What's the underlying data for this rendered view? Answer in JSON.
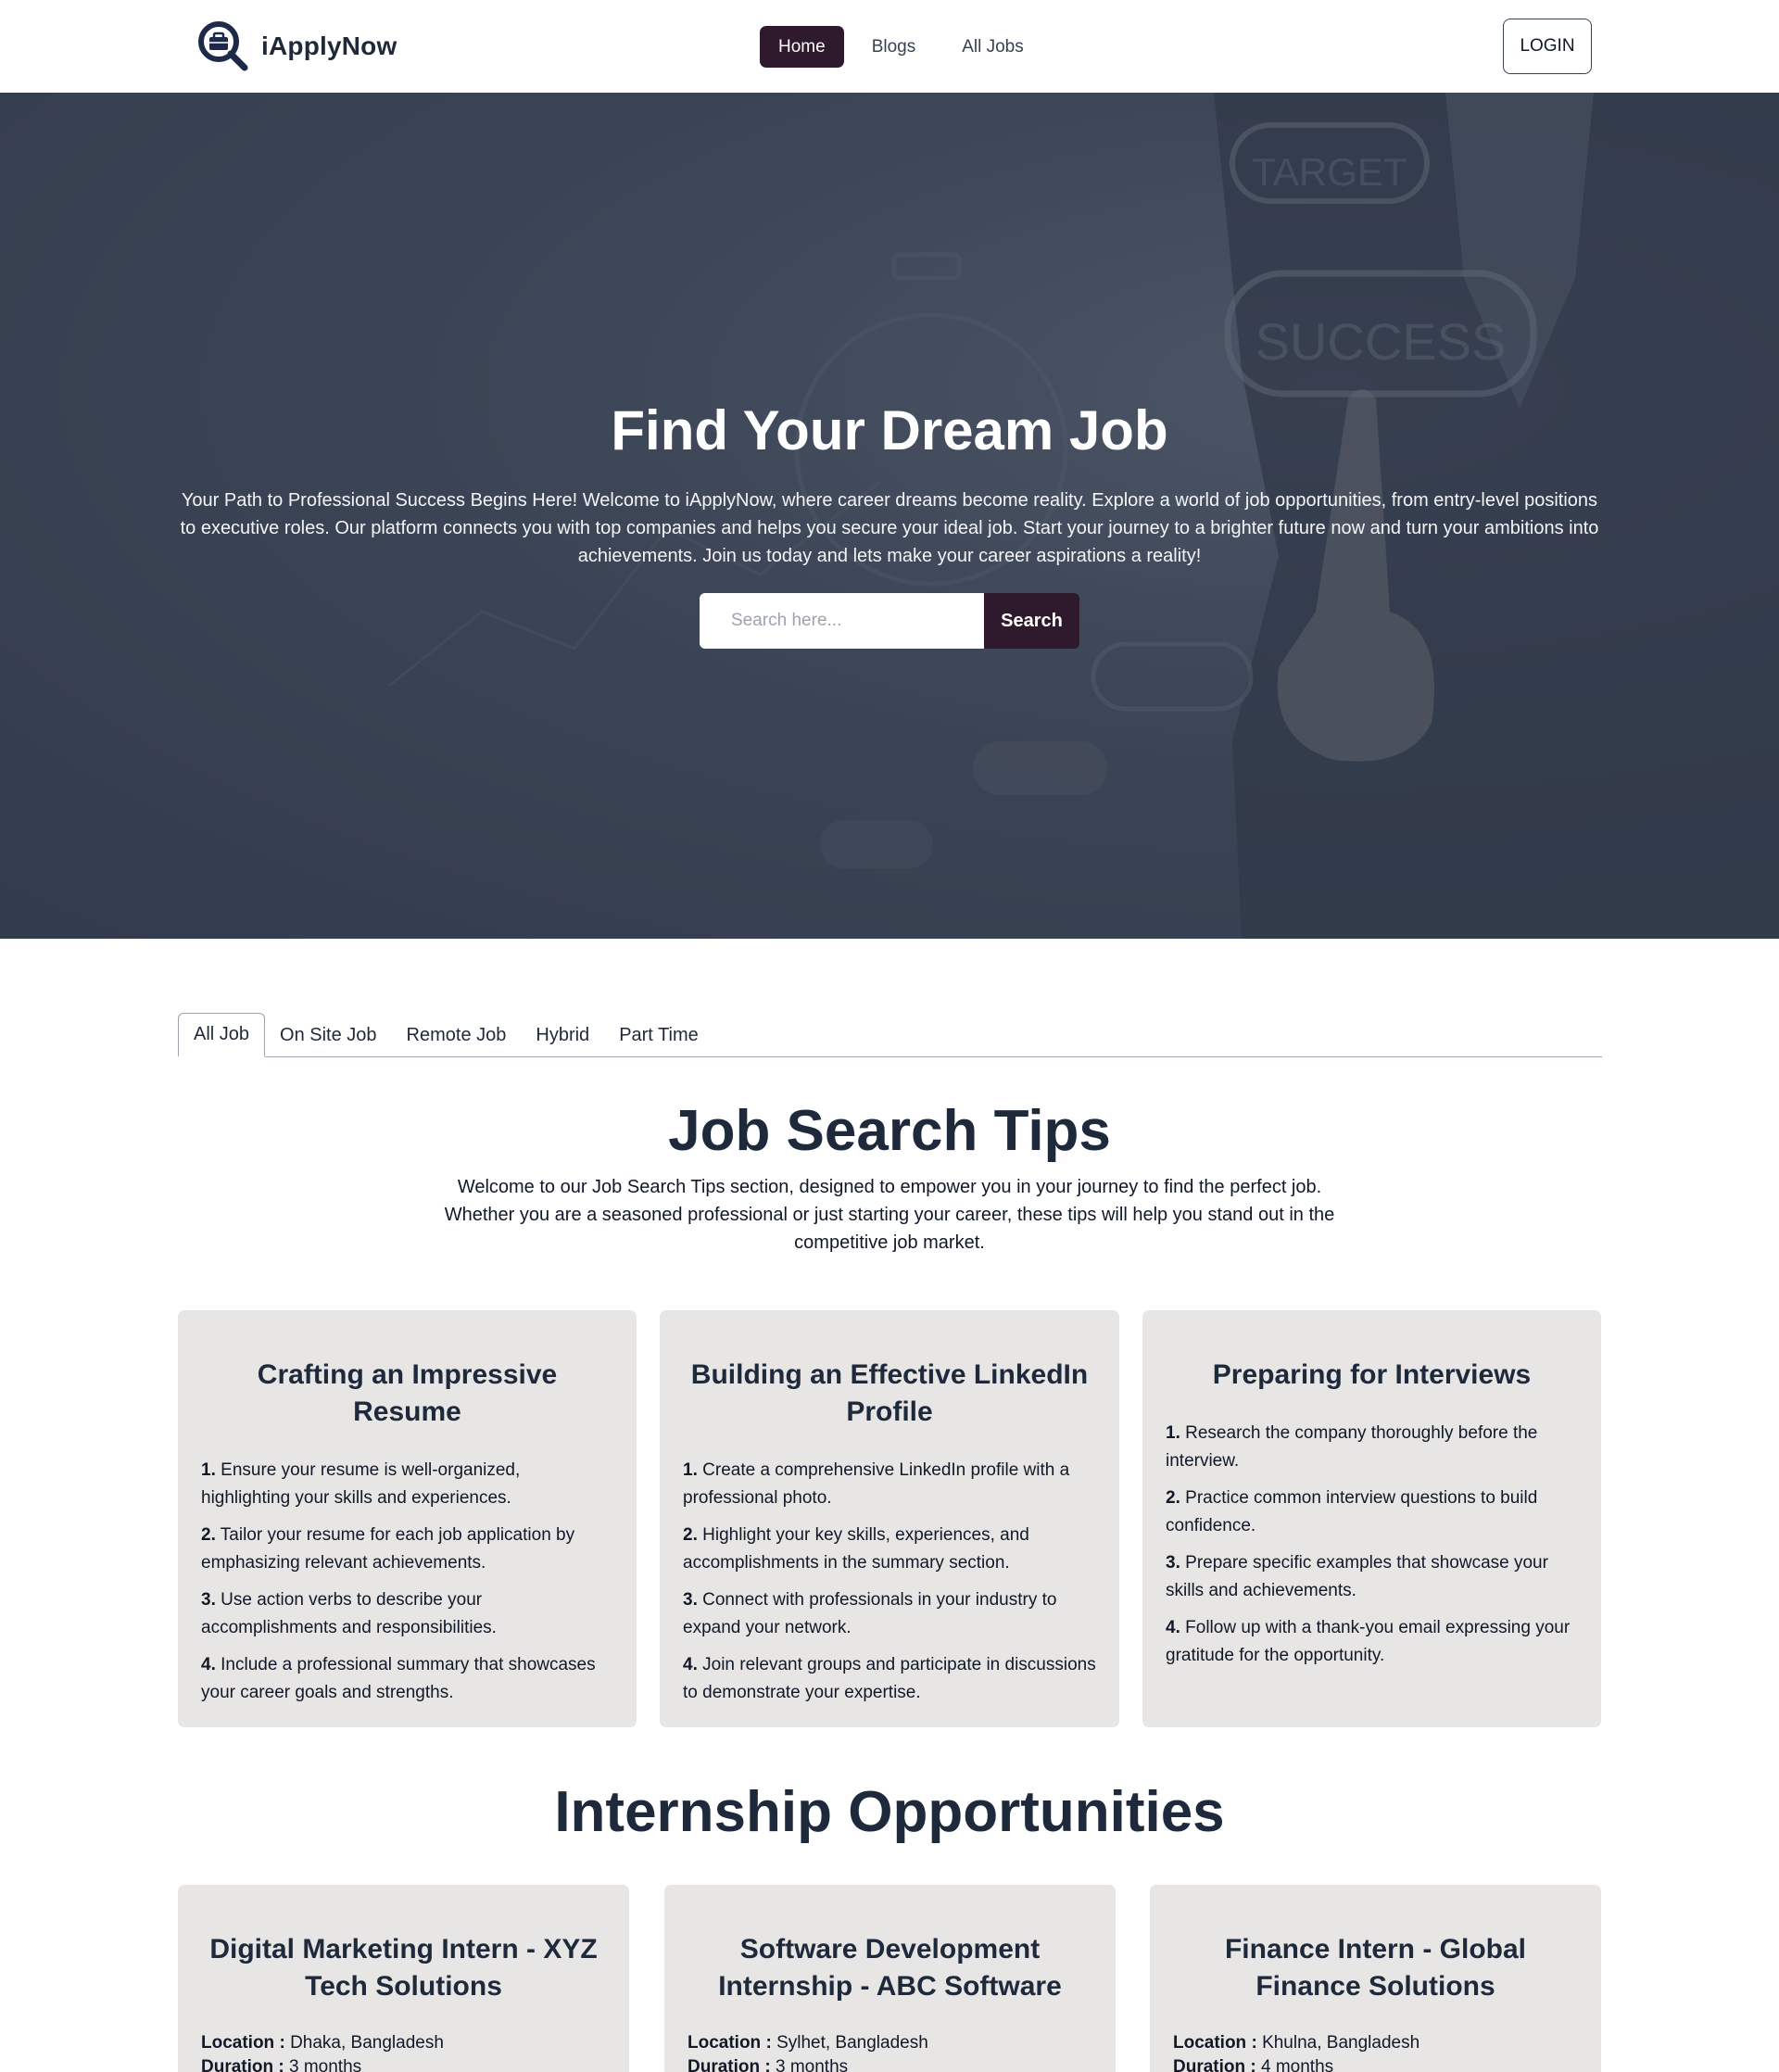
{
  "navbar": {
    "brand": "iApplyNow",
    "links": [
      "Home",
      "Blogs",
      "All Jobs"
    ],
    "active_index": 0,
    "login": "LOGIN"
  },
  "hero": {
    "title": "Find Your Dream Job",
    "text": "Your Path to Professional Success Begins Here! Welcome to iApplyNow, where career dreams become reality. Explore a world of job opportunities, from entry-level positions to executive roles. Our platform connects you with top companies and helps you secure your ideal job. Start your journey to a brighter future now and turn your ambitions into achievements. Join us today and lets make your career aspirations a reality!",
    "search_placeholder": "Search here...",
    "search_button": "Search",
    "background_words": [
      "TARGET",
      "SUCCESS"
    ]
  },
  "tabs": [
    "All Job",
    "On Site Job",
    "Remote Job",
    "Hybrid",
    "Part Time"
  ],
  "tips": {
    "title": "Job Search Tips",
    "intro": "Welcome to our Job Search Tips section, designed to empower you in your journey to find the perfect job. Whether you are a seasoned professional or just starting your career, these tips will help you stand out in the competitive job market.",
    "cards": [
      {
        "title": "Crafting an Impressive Resume",
        "items": [
          {
            "num": "1.",
            "text": "Ensure your resume is well-organized, highlighting your skills and experiences."
          },
          {
            "num": "2.",
            "text": "Tailor your resume for each job application by emphasizing relevant achievements."
          },
          {
            "num": "3.",
            "text": "Use action verbs to describe your accomplishments and responsibilities."
          },
          {
            "num": "4.",
            "text": "Include a professional summary that showcases your career goals and strengths."
          }
        ]
      },
      {
        "title": "Building an Effective LinkedIn Profile",
        "items": [
          {
            "num": "1.",
            "text": "Create a comprehensive LinkedIn profile with a professional photo."
          },
          {
            "num": "2.",
            "text": "Highlight your key skills, experiences, and accomplishments in the summary section."
          },
          {
            "num": "3.",
            "text": "Connect with professionals in your industry to expand your network."
          },
          {
            "num": "4.",
            "text": "Join relevant groups and participate in discussions to demonstrate your expertise."
          }
        ]
      },
      {
        "title": "Preparing for Interviews",
        "items": [
          {
            "num": "1.",
            "text": "Research the company thoroughly before the interview."
          },
          {
            "num": "2.",
            "text": "Practice common interview questions to build confidence."
          },
          {
            "num": "3.",
            "text": "Prepare specific examples that showcase your skills and achievements."
          },
          {
            "num": "4.",
            "text": "Follow up with a thank-you email expressing your gratitude for the opportunity."
          }
        ]
      }
    ]
  },
  "internships": {
    "title": "Internship Opportunities",
    "location_label": "Location :",
    "duration_label": "Duration :",
    "cards": [
      {
        "title": "Digital Marketing Intern - XYZ Tech Solutions",
        "location": "Dhaka, Bangladesh",
        "duration": "3 months"
      },
      {
        "title": "Software Development Internship - ABC Software",
        "location": "Sylhet, Bangladesh",
        "duration": "3 months"
      },
      {
        "title": "Finance Intern - Global Finance Solutions",
        "location": "Khulna, Bangladesh",
        "duration": "4 months"
      }
    ]
  },
  "colors": {
    "accent": "#2e1a2c",
    "card_bg": "#e7e6e5",
    "heading": "#1e293b",
    "logo": "#1e2a4a"
  }
}
